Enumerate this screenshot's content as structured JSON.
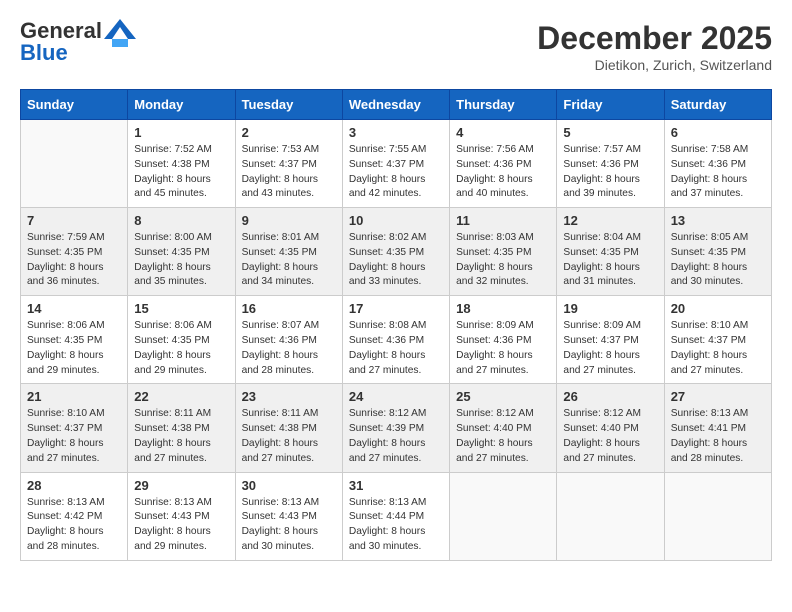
{
  "header": {
    "logo_general": "General",
    "logo_blue": "Blue",
    "month": "December 2025",
    "location": "Dietikon, Zurich, Switzerland"
  },
  "weekdays": [
    "Sunday",
    "Monday",
    "Tuesday",
    "Wednesday",
    "Thursday",
    "Friday",
    "Saturday"
  ],
  "weeks": [
    [
      {
        "day": "",
        "empty": true
      },
      {
        "day": "1",
        "sunrise": "Sunrise: 7:52 AM",
        "sunset": "Sunset: 4:38 PM",
        "daylight": "Daylight: 8 hours and 45 minutes."
      },
      {
        "day": "2",
        "sunrise": "Sunrise: 7:53 AM",
        "sunset": "Sunset: 4:37 PM",
        "daylight": "Daylight: 8 hours and 43 minutes."
      },
      {
        "day": "3",
        "sunrise": "Sunrise: 7:55 AM",
        "sunset": "Sunset: 4:37 PM",
        "daylight": "Daylight: 8 hours and 42 minutes."
      },
      {
        "day": "4",
        "sunrise": "Sunrise: 7:56 AM",
        "sunset": "Sunset: 4:36 PM",
        "daylight": "Daylight: 8 hours and 40 minutes."
      },
      {
        "day": "5",
        "sunrise": "Sunrise: 7:57 AM",
        "sunset": "Sunset: 4:36 PM",
        "daylight": "Daylight: 8 hours and 39 minutes."
      },
      {
        "day": "6",
        "sunrise": "Sunrise: 7:58 AM",
        "sunset": "Sunset: 4:36 PM",
        "daylight": "Daylight: 8 hours and 37 minutes."
      }
    ],
    [
      {
        "day": "7",
        "sunrise": "Sunrise: 7:59 AM",
        "sunset": "Sunset: 4:35 PM",
        "daylight": "Daylight: 8 hours and 36 minutes."
      },
      {
        "day": "8",
        "sunrise": "Sunrise: 8:00 AM",
        "sunset": "Sunset: 4:35 PM",
        "daylight": "Daylight: 8 hours and 35 minutes."
      },
      {
        "day": "9",
        "sunrise": "Sunrise: 8:01 AM",
        "sunset": "Sunset: 4:35 PM",
        "daylight": "Daylight: 8 hours and 34 minutes."
      },
      {
        "day": "10",
        "sunrise": "Sunrise: 8:02 AM",
        "sunset": "Sunset: 4:35 PM",
        "daylight": "Daylight: 8 hours and 33 minutes."
      },
      {
        "day": "11",
        "sunrise": "Sunrise: 8:03 AM",
        "sunset": "Sunset: 4:35 PM",
        "daylight": "Daylight: 8 hours and 32 minutes."
      },
      {
        "day": "12",
        "sunrise": "Sunrise: 8:04 AM",
        "sunset": "Sunset: 4:35 PM",
        "daylight": "Daylight: 8 hours and 31 minutes."
      },
      {
        "day": "13",
        "sunrise": "Sunrise: 8:05 AM",
        "sunset": "Sunset: 4:35 PM",
        "daylight": "Daylight: 8 hours and 30 minutes."
      }
    ],
    [
      {
        "day": "14",
        "sunrise": "Sunrise: 8:06 AM",
        "sunset": "Sunset: 4:35 PM",
        "daylight": "Daylight: 8 hours and 29 minutes."
      },
      {
        "day": "15",
        "sunrise": "Sunrise: 8:06 AM",
        "sunset": "Sunset: 4:35 PM",
        "daylight": "Daylight: 8 hours and 29 minutes."
      },
      {
        "day": "16",
        "sunrise": "Sunrise: 8:07 AM",
        "sunset": "Sunset: 4:36 PM",
        "daylight": "Daylight: 8 hours and 28 minutes."
      },
      {
        "day": "17",
        "sunrise": "Sunrise: 8:08 AM",
        "sunset": "Sunset: 4:36 PM",
        "daylight": "Daylight: 8 hours and 27 minutes."
      },
      {
        "day": "18",
        "sunrise": "Sunrise: 8:09 AM",
        "sunset": "Sunset: 4:36 PM",
        "daylight": "Daylight: 8 hours and 27 minutes."
      },
      {
        "day": "19",
        "sunrise": "Sunrise: 8:09 AM",
        "sunset": "Sunset: 4:37 PM",
        "daylight": "Daylight: 8 hours and 27 minutes."
      },
      {
        "day": "20",
        "sunrise": "Sunrise: 8:10 AM",
        "sunset": "Sunset: 4:37 PM",
        "daylight": "Daylight: 8 hours and 27 minutes."
      }
    ],
    [
      {
        "day": "21",
        "sunrise": "Sunrise: 8:10 AM",
        "sunset": "Sunset: 4:37 PM",
        "daylight": "Daylight: 8 hours and 27 minutes."
      },
      {
        "day": "22",
        "sunrise": "Sunrise: 8:11 AM",
        "sunset": "Sunset: 4:38 PM",
        "daylight": "Daylight: 8 hours and 27 minutes."
      },
      {
        "day": "23",
        "sunrise": "Sunrise: 8:11 AM",
        "sunset": "Sunset: 4:38 PM",
        "daylight": "Daylight: 8 hours and 27 minutes."
      },
      {
        "day": "24",
        "sunrise": "Sunrise: 8:12 AM",
        "sunset": "Sunset: 4:39 PM",
        "daylight": "Daylight: 8 hours and 27 minutes."
      },
      {
        "day": "25",
        "sunrise": "Sunrise: 8:12 AM",
        "sunset": "Sunset: 4:40 PM",
        "daylight": "Daylight: 8 hours and 27 minutes."
      },
      {
        "day": "26",
        "sunrise": "Sunrise: 8:12 AM",
        "sunset": "Sunset: 4:40 PM",
        "daylight": "Daylight: 8 hours and 27 minutes."
      },
      {
        "day": "27",
        "sunrise": "Sunrise: 8:13 AM",
        "sunset": "Sunset: 4:41 PM",
        "daylight": "Daylight: 8 hours and 28 minutes."
      }
    ],
    [
      {
        "day": "28",
        "sunrise": "Sunrise: 8:13 AM",
        "sunset": "Sunset: 4:42 PM",
        "daylight": "Daylight: 8 hours and 28 minutes."
      },
      {
        "day": "29",
        "sunrise": "Sunrise: 8:13 AM",
        "sunset": "Sunset: 4:43 PM",
        "daylight": "Daylight: 8 hours and 29 minutes."
      },
      {
        "day": "30",
        "sunrise": "Sunrise: 8:13 AM",
        "sunset": "Sunset: 4:43 PM",
        "daylight": "Daylight: 8 hours and 30 minutes."
      },
      {
        "day": "31",
        "sunrise": "Sunrise: 8:13 AM",
        "sunset": "Sunset: 4:44 PM",
        "daylight": "Daylight: 8 hours and 30 minutes."
      },
      {
        "day": "",
        "empty": true
      },
      {
        "day": "",
        "empty": true
      },
      {
        "day": "",
        "empty": true
      }
    ]
  ]
}
